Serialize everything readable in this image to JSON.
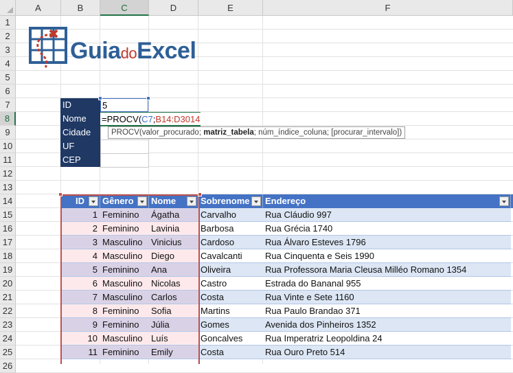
{
  "columns": [
    "A",
    "B",
    "C",
    "D",
    "E",
    "F"
  ],
  "rows": [
    "1",
    "2",
    "3",
    "4",
    "5",
    "6",
    "7",
    "8",
    "9",
    "10",
    "11",
    "12",
    "13",
    "14",
    "15",
    "16",
    "17",
    "18",
    "19",
    "20",
    "21",
    "22",
    "23",
    "24",
    "25",
    "26"
  ],
  "logo": {
    "word_a": "Guia",
    "word_b": "do",
    "word_c": "Excel",
    "colors": {
      "blue": "#2e5f96",
      "red": "#c0392b"
    }
  },
  "lookup_form": {
    "labels": [
      "ID",
      "Nome",
      "Cidade",
      "UF",
      "CEP"
    ],
    "id_value": "5",
    "formula": {
      "prefix": "=PROCV(",
      "ref1": "C7",
      "sep": ";",
      "ref2": "B14:D3014"
    }
  },
  "tooltip": {
    "pre": "PROCV(valor_procurado; ",
    "bold": "matriz_tabela",
    "post": "; núm_índice_coluna; [procurar_intervalo])"
  },
  "table": {
    "headers": [
      "ID",
      "Gênero",
      "Nome",
      "Sobrenome",
      "Endereço"
    ],
    "rows": [
      [
        "1",
        "Feminino",
        "Ágatha",
        "Carvalho",
        "Rua Cláudio 997"
      ],
      [
        "2",
        "Feminino",
        "Lavinia",
        "Barbosa",
        "Rua Grécia 1740"
      ],
      [
        "3",
        "Masculino",
        "Vinicius",
        "Cardoso",
        "Rua Álvaro Esteves 1796"
      ],
      [
        "4",
        "Masculino",
        "Diego",
        "Cavalcanti",
        "Rua Cinquenta e Seis 1990"
      ],
      [
        "5",
        "Feminino",
        "Ana",
        "Oliveira",
        "Rua Professora Maria Cleusa Milléo Romano 1354"
      ],
      [
        "6",
        "Masculino",
        "Nicolas",
        "Castro",
        "Estrada do Bananal 955"
      ],
      [
        "7",
        "Masculino",
        "Carlos",
        "Costa",
        "Rua Vinte e Sete 1160"
      ],
      [
        "8",
        "Feminino",
        "Sofia",
        "Martins",
        "Rua Paulo Brandao 371"
      ],
      [
        "9",
        "Feminino",
        "Júlia",
        "Gomes",
        "Avenida dos Pinheiros 1352"
      ],
      [
        "10",
        "Masculino",
        "Luís",
        "Goncalves",
        "Rua Imperatriz Leopoldina 24"
      ],
      [
        "11",
        "Feminino",
        "Emily",
        "Costa",
        "Rua Ouro Preto 514"
      ]
    ]
  }
}
